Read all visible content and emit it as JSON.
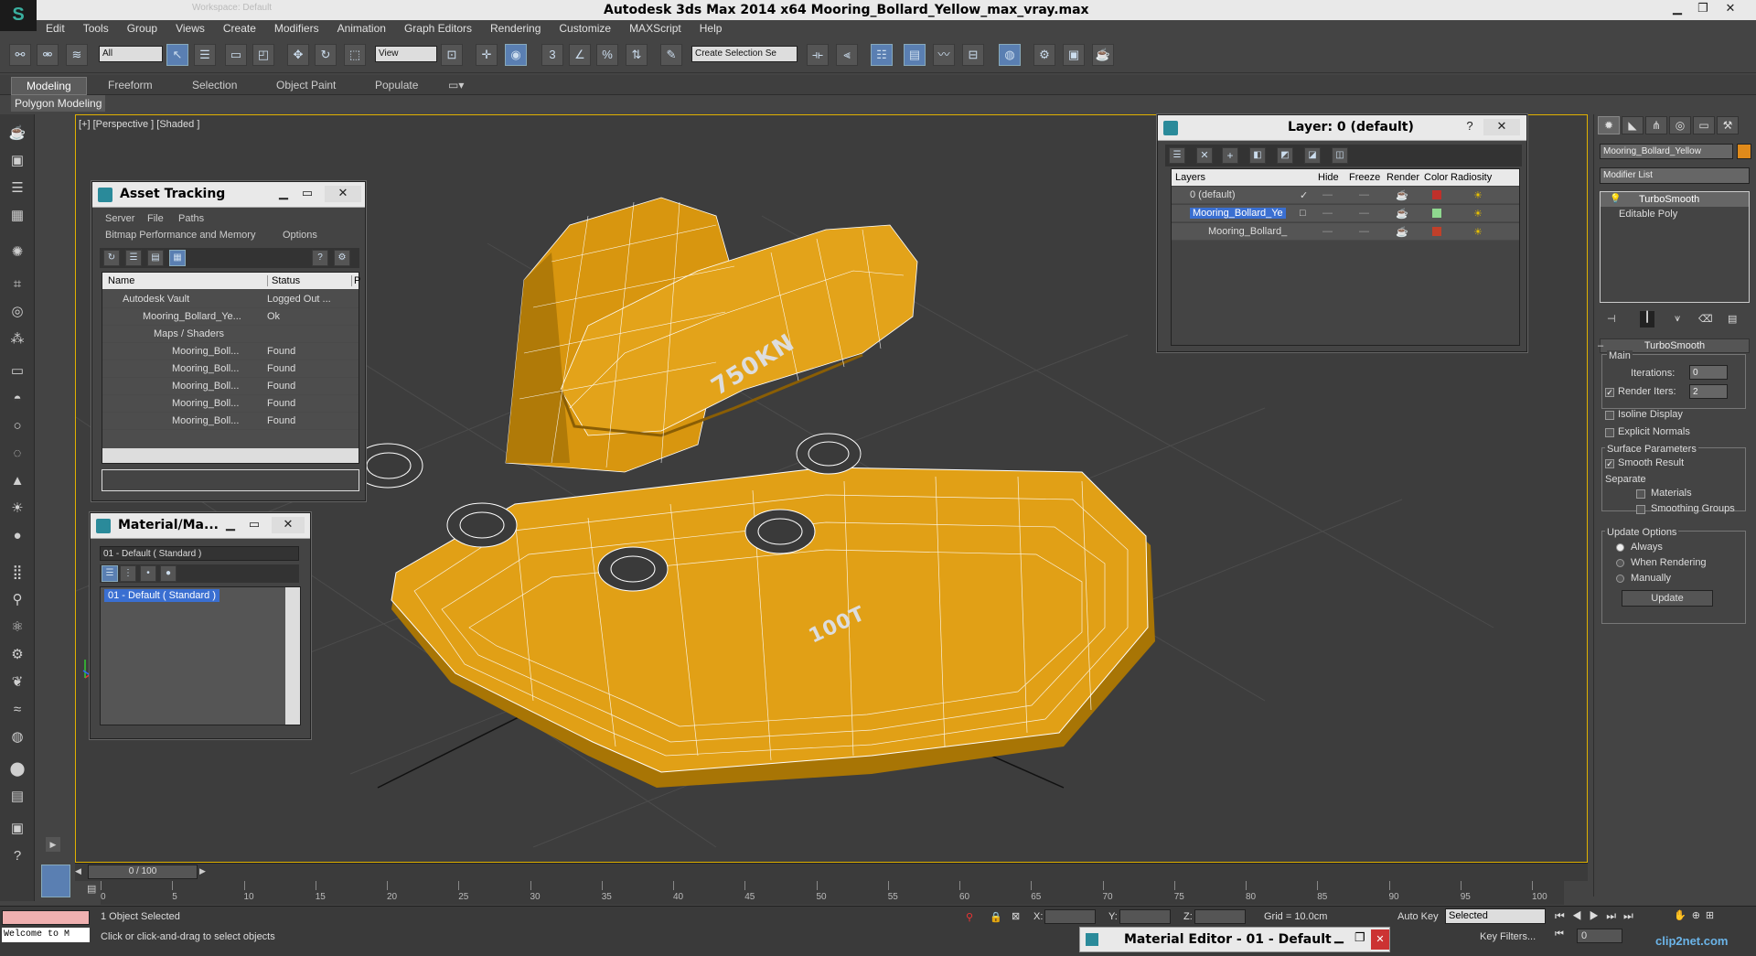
{
  "title": "Autodesk 3ds Max  2014 x64     Mooring_Bollard_Yellow_max_vray.max",
  "workspace": "Workspace: Default",
  "menus": [
    "Edit",
    "Tools",
    "Group",
    "Views",
    "Create",
    "Modifiers",
    "Animation",
    "Graph Editors",
    "Rendering",
    "Customize",
    "MAXScript",
    "Help"
  ],
  "toolbar": {
    "selection_filter": "All",
    "ref_coord": "View",
    "named_sel": "Create Selection Se"
  },
  "ribbon": {
    "tabs": [
      "Modeling",
      "Freeform",
      "Selection",
      "Object Paint",
      "Populate"
    ],
    "active": "Modeling",
    "sub": "Polygon Modeling"
  },
  "viewport": {
    "label": "[+] [Perspective ] [Shaded ]",
    "text_top": "750KN",
    "text_bottom": "100T"
  },
  "asset_tracking": {
    "title": "Asset Tracking",
    "menu1": [
      "Server",
      "File",
      "Paths"
    ],
    "menu2": [
      "Bitmap Performance and Memory",
      "Options"
    ],
    "columns": [
      "Name",
      "Status",
      "P"
    ],
    "rows": [
      {
        "name": "Autodesk Vault",
        "status": "Logged Out ..."
      },
      {
        "name": "Mooring_Bollard_Ye...",
        "status": "Ok"
      },
      {
        "name": "Maps / Shaders",
        "status": ""
      },
      {
        "name": "Mooring_Boll...",
        "status": "Found"
      },
      {
        "name": "Mooring_Boll...",
        "status": "Found"
      },
      {
        "name": "Mooring_Boll...",
        "status": "Found"
      },
      {
        "name": "Mooring_Boll...",
        "status": "Found"
      },
      {
        "name": "Mooring_Boll...",
        "status": "Found"
      }
    ]
  },
  "material_browser": {
    "title": "Material/Ma...",
    "field": "01 - Default  ( Standard )",
    "item": "01 - Default  ( Standard )"
  },
  "layer_manager": {
    "title": "Layer: 0 (default)",
    "help": "?",
    "columns": [
      "Layers",
      "Hide",
      "Freeze",
      "Render",
      "Color",
      "Radiosity"
    ],
    "rows": [
      {
        "name": "0 (default)",
        "color": "#c0302a"
      },
      {
        "name": "Mooring_Bollard_Ye",
        "color": "#8fd88f"
      },
      {
        "name": "Mooring_Bollard_",
        "color": "#c0402a"
      }
    ]
  },
  "command_panel": {
    "object_name": "Mooring_Bollard_Yellow",
    "object_color": "#e08a1a",
    "modifier_list": "Modifier List",
    "stack": [
      "TurboSmooth",
      "Editable Poly"
    ],
    "rollout": "TurboSmooth",
    "main": "Main",
    "iterations_label": "Iterations:",
    "iterations": "0",
    "render_iters_label": "Render Iters:",
    "render_iters": "2",
    "isoline": "Isoline Display",
    "explicit": "Explicit Normals",
    "surface": "Surface Parameters",
    "smooth_result": "Smooth Result",
    "separate": "Separate",
    "materials": "Materials",
    "smoothing_groups": "Smoothing Groups",
    "update_options": "Update Options",
    "always": "Always",
    "when_rendering": "When Rendering",
    "manually": "Manually",
    "update": "Update"
  },
  "time": {
    "slider": "0 / 100",
    "ticks": [
      "0",
      "5",
      "10",
      "15",
      "20",
      "25",
      "30",
      "35",
      "40",
      "45",
      "50",
      "55",
      "60",
      "65",
      "70",
      "75",
      "80",
      "85",
      "90",
      "95",
      "100"
    ]
  },
  "status": {
    "maxscript": "Welcome to M",
    "selected": "1 Object Selected",
    "prompt": "Click or click-and-drag to select objects",
    "x_label": "X:",
    "y_label": "Y:",
    "z_label": "Z:",
    "grid": "Grid = 10.0cm",
    "auto_key": "Auto Key",
    "set_key_filter": "Selected",
    "key_filters": "Key Filters...",
    "frame": "0"
  },
  "mini_editor": {
    "title": "Material Editor - 01 - Default"
  },
  "watermark": "clip2net.com"
}
